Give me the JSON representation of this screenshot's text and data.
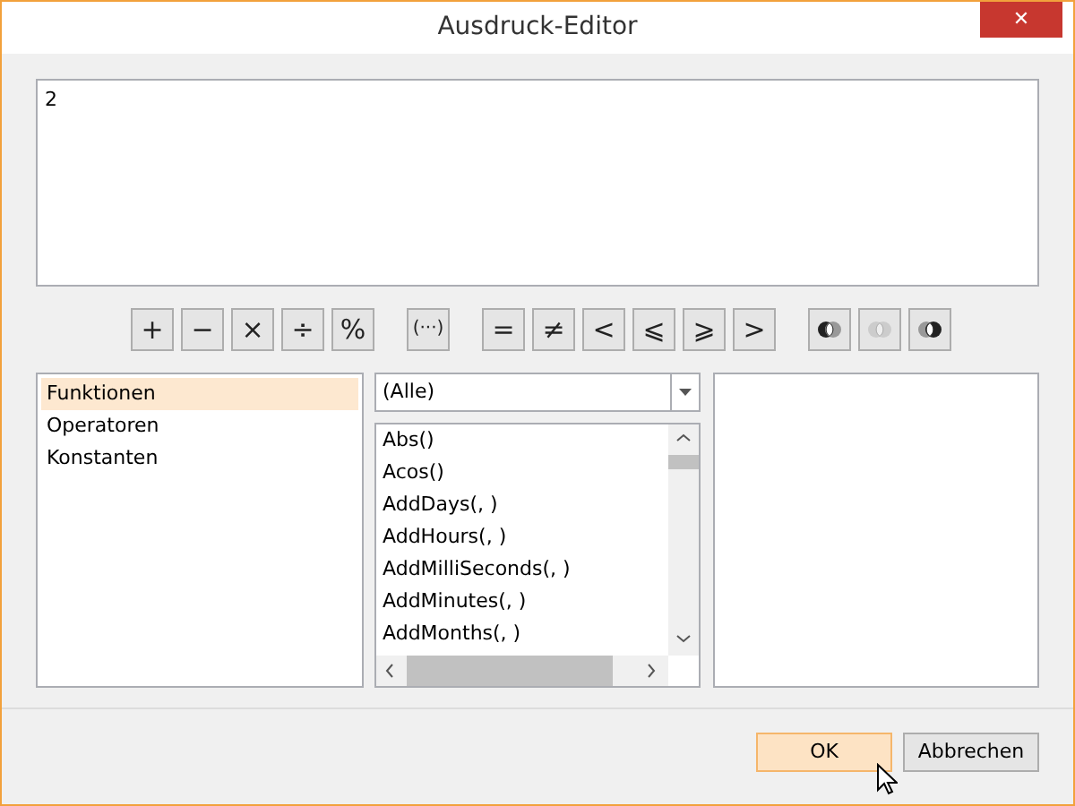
{
  "window": {
    "title": "Ausdruck-Editor",
    "close": "✕"
  },
  "editor": {
    "value": "2"
  },
  "operators": [
    [
      {
        "kind": "text",
        "label": "+"
      },
      {
        "kind": "text",
        "label": "−"
      },
      {
        "kind": "text",
        "label": "×"
      },
      {
        "kind": "text",
        "label": "÷"
      },
      {
        "kind": "text",
        "label": "%"
      }
    ],
    [
      {
        "kind": "text",
        "label": "(···)"
      }
    ],
    [
      {
        "kind": "text",
        "label": "="
      },
      {
        "kind": "text",
        "label": "≠"
      },
      {
        "kind": "text",
        "label": "<"
      },
      {
        "kind": "text",
        "label": "⩽"
      },
      {
        "kind": "text",
        "label": "⩾"
      },
      {
        "kind": "text",
        "label": ">"
      }
    ],
    [
      {
        "kind": "venn-left"
      },
      {
        "kind": "venn-faded"
      },
      {
        "kind": "venn-right"
      }
    ]
  ],
  "categories": [
    {
      "label": "Funktionen",
      "selected": true
    },
    {
      "label": "Operatoren",
      "selected": false
    },
    {
      "label": "Konstanten",
      "selected": false
    }
  ],
  "filter": {
    "value": "(Alle)"
  },
  "functions": [
    {
      "label": "Abs()"
    },
    {
      "label": "Acos()"
    },
    {
      "label": "AddDays(, )"
    },
    {
      "label": "AddHours(, )"
    },
    {
      "label": "AddMilliSeconds(, )"
    },
    {
      "label": "AddMinutes(, )"
    },
    {
      "label": "AddMonths(, )"
    }
  ],
  "buttons": [
    {
      "label": "OK",
      "default": true
    },
    {
      "label": "Abbrechen",
      "default": false
    }
  ]
}
